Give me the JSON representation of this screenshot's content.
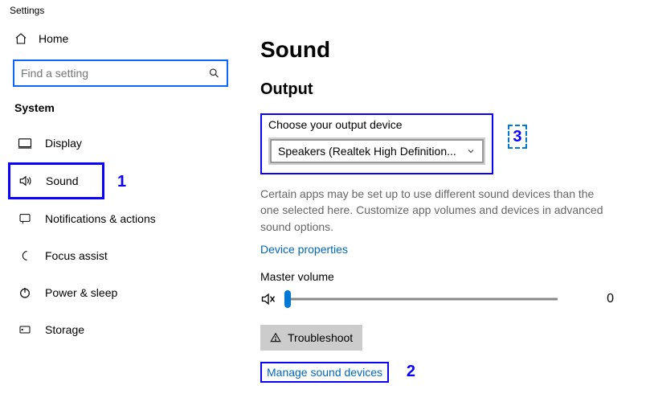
{
  "window_title": "Settings",
  "sidebar": {
    "home": "Home",
    "search_placeholder": "Find a setting",
    "group": "System",
    "items": [
      {
        "label": "Display"
      },
      {
        "label": "Sound"
      },
      {
        "label": "Notifications & actions"
      },
      {
        "label": "Focus assist"
      },
      {
        "label": "Power & sleep"
      },
      {
        "label": "Storage"
      }
    ]
  },
  "main": {
    "title": "Sound",
    "output_section": "Output",
    "output_label": "Choose your output device",
    "output_selected": "Speakers (Realtek High Definition...",
    "output_hint": "Certain apps may be set up to use different sound devices than the one selected here. Customize app volumes and devices in advanced sound options.",
    "device_properties": "Device properties",
    "master_volume_label": "Master volume",
    "master_volume_value": "0",
    "troubleshoot": "Troubleshoot",
    "manage": "Manage sound devices"
  },
  "annotations": {
    "one": "1",
    "two": "2",
    "three": "3"
  }
}
